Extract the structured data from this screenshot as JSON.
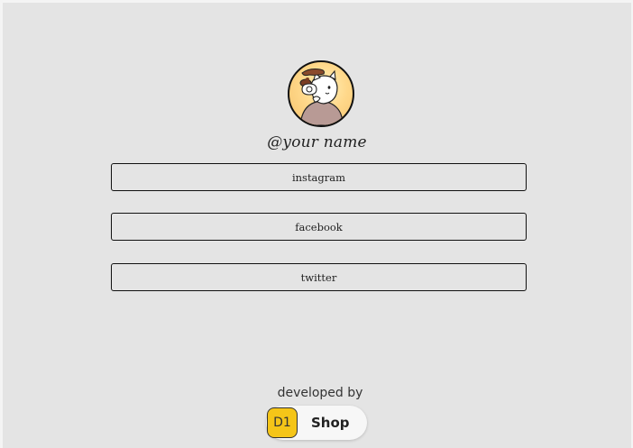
{
  "profile": {
    "username": "@your name",
    "avatar_icon": "cat-with-coffee-avatar"
  },
  "links": [
    {
      "label": "instagram"
    },
    {
      "label": "facebook"
    },
    {
      "label": "twitter"
    }
  ],
  "footer": {
    "developed_by_label": "developed by",
    "badge_logo_text": "D1",
    "badge_text": "Shop",
    "badge_color": "#f5c518"
  },
  "colors": {
    "background": "#e4e4e4",
    "border": "#111111"
  }
}
